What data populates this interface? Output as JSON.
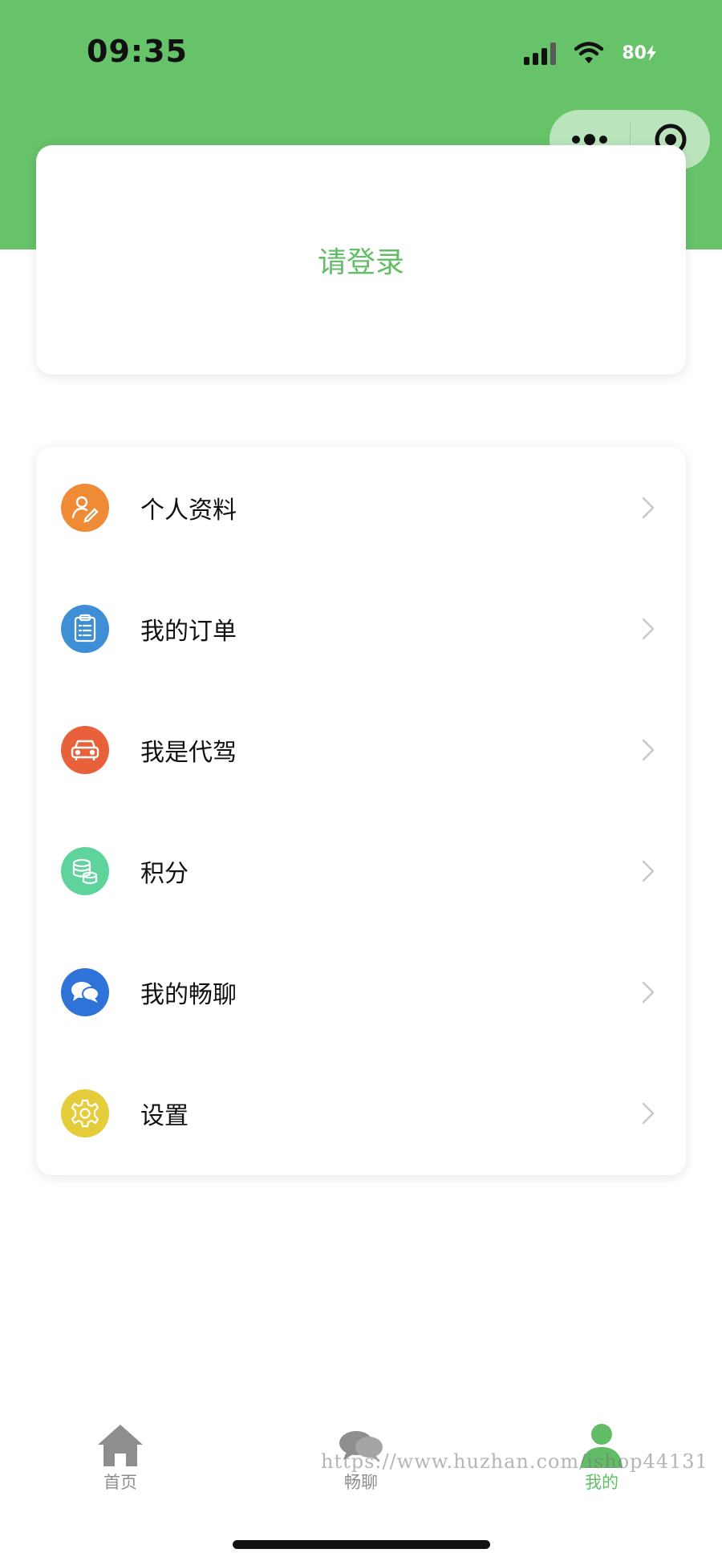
{
  "status_bar": {
    "time": "09:35",
    "battery": "80"
  },
  "capsule": {
    "more_icon": "more-dots-icon",
    "close_icon": "target-close-icon"
  },
  "login": {
    "label": "请登录"
  },
  "menu": {
    "items": [
      {
        "label": "个人资料",
        "icon": "profile-edit-icon",
        "color": "#ef8a35"
      },
      {
        "label": "我的订单",
        "icon": "clipboard-list-icon",
        "color": "#3f8fd6"
      },
      {
        "label": "我是代驾",
        "icon": "car-icon",
        "color": "#e9613a"
      },
      {
        "label": "积分",
        "icon": "coins-stack-icon",
        "color": "#5ed39c"
      },
      {
        "label": "我的畅聊",
        "icon": "chat-bubbles-icon",
        "color": "#2f72d8"
      },
      {
        "label": "设置",
        "icon": "gear-icon",
        "color": "#e5cc3a"
      }
    ]
  },
  "tabbar": {
    "tabs": [
      {
        "label": "首页",
        "icon": "home-icon",
        "active": false
      },
      {
        "label": "畅聊",
        "icon": "chat-icon",
        "active": false
      },
      {
        "label": "我的",
        "icon": "user-icon",
        "active": true
      }
    ]
  },
  "watermark": "https://www.huzhan.com/ishop44131",
  "colors": {
    "brand_green": "#66c36a",
    "active_green": "#62bd67",
    "inactive_gray": "#8e8e8e"
  }
}
